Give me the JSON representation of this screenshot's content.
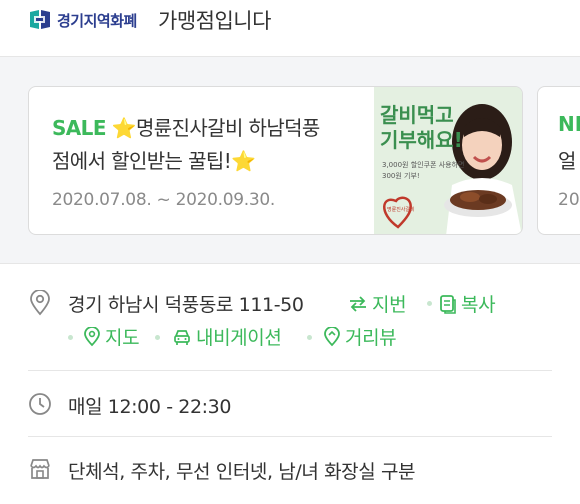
{
  "header": {
    "brand_name": "경기지역화폐",
    "suffix": "가맹점입니다"
  },
  "promo": {
    "main": {
      "tag": "SALE",
      "title_line1": "명륜진사갈비 하남덕풍",
      "title_line2": "점에서 할인받는 꿀팁!",
      "date_range": "2020.07.08. ~ 2020.09.30.",
      "image_text_line1": "갈비먹고",
      "image_text_line2": "기부해요!",
      "image_subtext_line1": "3,000원 할인쿠폰 사용하면",
      "image_subtext_line2": "300원 기부!",
      "image_badge": "명륜진사갈비"
    },
    "next": {
      "tag": "NE",
      "title_start": "얼",
      "date_start": "20"
    }
  },
  "store": {
    "address": "경기 하남시 덕풍동로 111-50",
    "hours": "매일 12:00 - 22:30",
    "amenities": "단체석, 주차, 무선 인터넷, 남/녀 화장실 구분"
  },
  "actions": {
    "jibun": "지번",
    "copy": "복사",
    "map": "지도",
    "navigation": "내비게이션",
    "street_view": "거리뷰"
  },
  "colors": {
    "accent_green": "#3cb95b",
    "brand_blue": "#2c3e8f",
    "brand_teal": "#1aa8a0",
    "band_gray": "#f4f5f7"
  }
}
